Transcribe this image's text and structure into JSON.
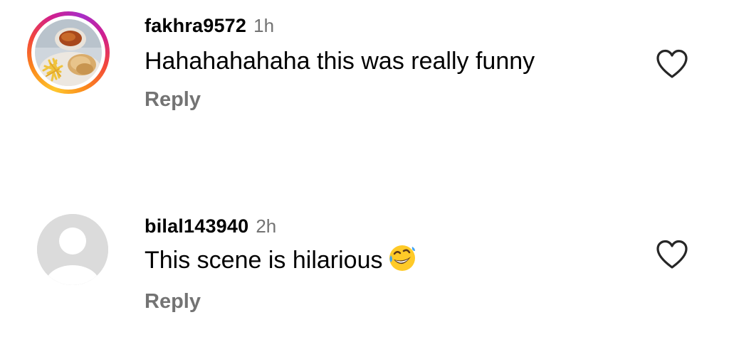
{
  "comments": [
    {
      "username": "fakhra9572",
      "time": "1h",
      "text": "Hahahahahaha this was really funny",
      "reply_label": "Reply",
      "has_story_ring": true,
      "avatar_icon": "food-photo-avatar",
      "like_icon": "heart-outline-icon"
    },
    {
      "username": "bilal143940",
      "time": "2h",
      "text": "This scene is hilarious",
      "emoji": "rolling-on-floor-laughing-emoji",
      "reply_label": "Reply",
      "has_story_ring": false,
      "avatar_icon": "default-user-avatar",
      "like_icon": "heart-outline-icon"
    }
  ],
  "colors": {
    "text": "#000000",
    "secondary": "#737373",
    "placeholder_avatar": "#dbdbdb",
    "ring_gradient": [
      "#fec72e",
      "#fb8a1c",
      "#f3483a",
      "#d11f8e",
      "#a72ec7"
    ]
  }
}
